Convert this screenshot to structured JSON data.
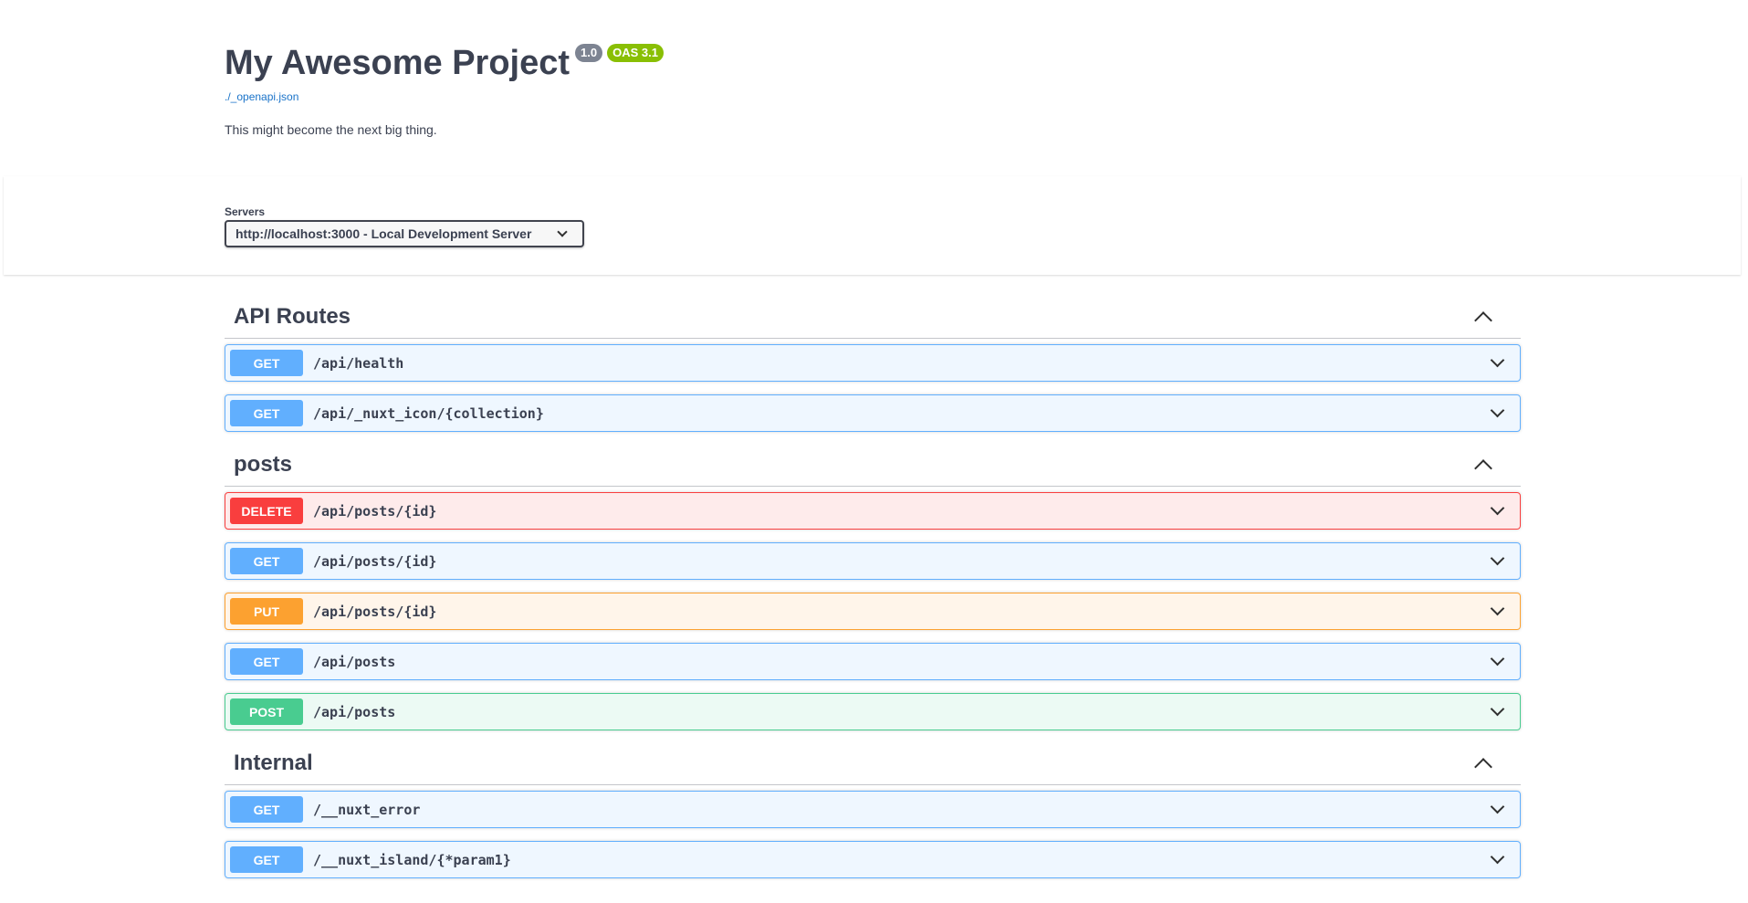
{
  "info": {
    "title": "My Awesome Project",
    "version": "1.0",
    "oas": "OAS 3.1",
    "spec_link": "./_openapi.json",
    "description": "This might become the next big thing."
  },
  "servers": {
    "label": "Servers",
    "selected": "http://localhost:3000 - Local Development Server"
  },
  "tags": [
    {
      "name": "API Routes",
      "operations": [
        {
          "method": "GET",
          "path": "/api/health"
        },
        {
          "method": "GET",
          "path": "/api/_nuxt_icon/{collection}"
        }
      ]
    },
    {
      "name": "posts",
      "operations": [
        {
          "method": "DELETE",
          "path": "/api/posts/{id}"
        },
        {
          "method": "GET",
          "path": "/api/posts/{id}"
        },
        {
          "method": "PUT",
          "path": "/api/posts/{id}"
        },
        {
          "method": "GET",
          "path": "/api/posts"
        },
        {
          "method": "POST",
          "path": "/api/posts"
        }
      ]
    },
    {
      "name": "Internal",
      "operations": [
        {
          "method": "GET",
          "path": "/__nuxt_error"
        },
        {
          "method": "GET",
          "path": "/__nuxt_island/{*param1}"
        }
      ]
    }
  ]
}
